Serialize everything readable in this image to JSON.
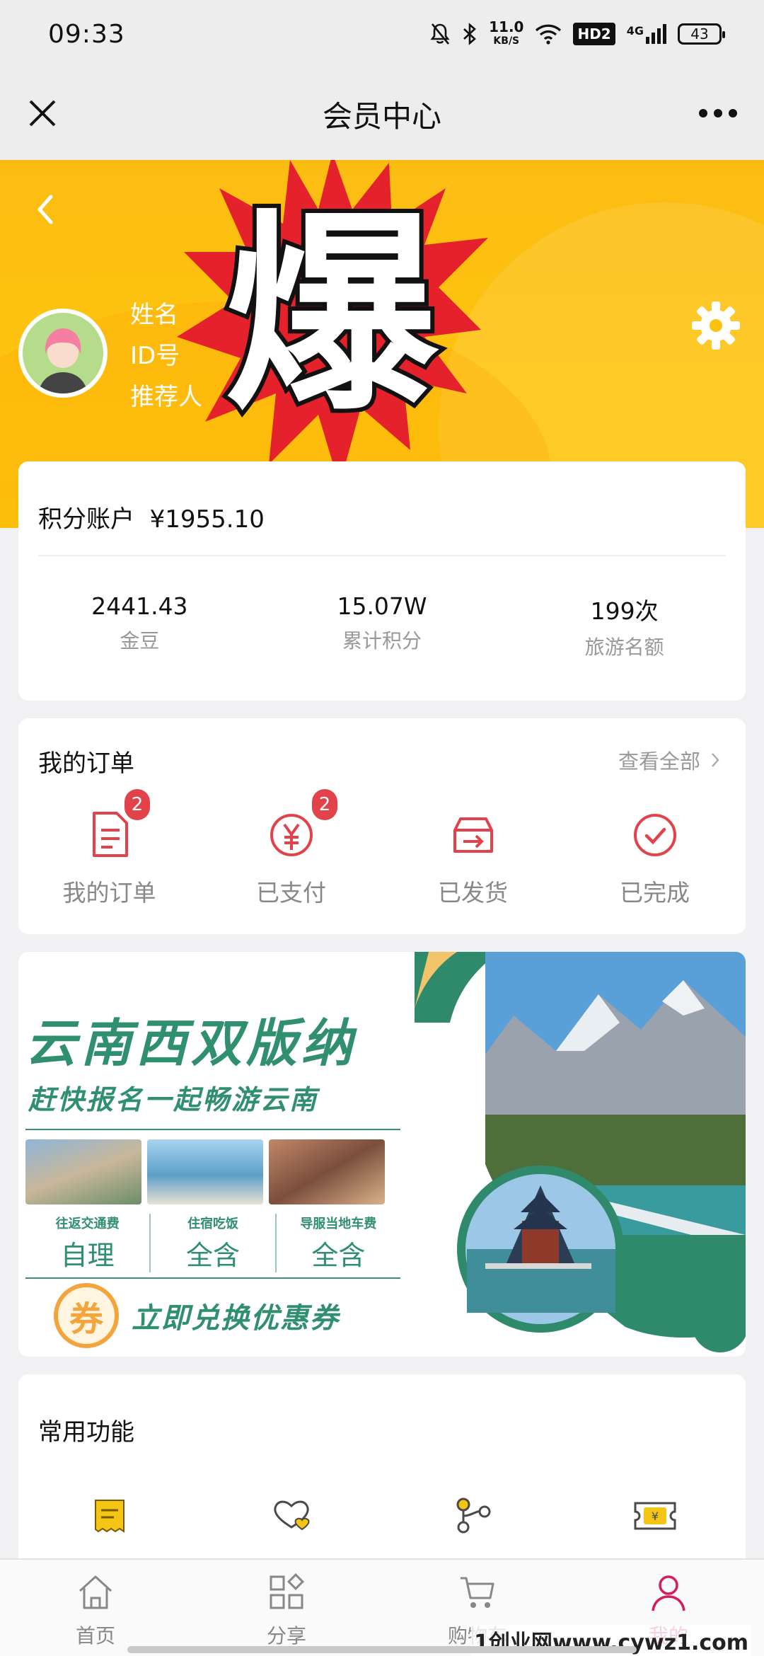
{
  "status_bar": {
    "time": "09:33",
    "net_speed_top": "11.0",
    "net_speed_bottom": "KB/S",
    "hd": "HD2",
    "signal": "4G",
    "battery": "43"
  },
  "title_bar": {
    "title": "会员中心"
  },
  "hero": {
    "name_label": "姓名",
    "id_label": "ID号",
    "referrer_label": "推荐人",
    "sticker": "爆",
    "colors": {
      "bg": "#fdc10f",
      "sticker_red": "#e5222b"
    }
  },
  "points": {
    "title": "积分账户",
    "balance": "¥1955.10",
    "stats": [
      {
        "value": "2441.43",
        "label": "金豆"
      },
      {
        "value": "15.07W",
        "label": "累计积分"
      },
      {
        "value": "199次",
        "label": "旅游名额"
      }
    ]
  },
  "orders": {
    "title": "我的订单",
    "view_all": "查看全部",
    "items": [
      {
        "label": "我的订单",
        "badge": "2",
        "icon": "document-icon"
      },
      {
        "label": "已支付",
        "badge": "2",
        "icon": "yuan-circle-icon"
      },
      {
        "label": "已发货",
        "badge": "",
        "icon": "shipping-box-icon"
      },
      {
        "label": "已完成",
        "badge": "",
        "icon": "check-circle-icon"
      }
    ],
    "accent": "#e2434b"
  },
  "banner": {
    "title": "云南西双版纳",
    "subtitle": "赶快报名一起畅游云南",
    "features": [
      {
        "small": "往返交通费",
        "big": "自理"
      },
      {
        "small": "住宿吃饭",
        "big": "全含"
      },
      {
        "small": "导服当地车费",
        "big": "全含"
      }
    ],
    "coupon_glyph": "券",
    "coupon_text": "立即兑换优惠券",
    "accent": "#2f8f6e"
  },
  "functions": {
    "title": "常用功能",
    "icons": [
      "receipt-icon",
      "heart-hand-icon",
      "share-nodes-icon",
      "ticket-icon"
    ]
  },
  "bottom_nav": {
    "items": [
      {
        "label": "首页",
        "icon": "home-icon"
      },
      {
        "label": "分享",
        "icon": "grid-icon"
      },
      {
        "label": "购物车",
        "icon": "cart-icon"
      },
      {
        "label": "我的",
        "icon": "person-icon",
        "active": true
      }
    ],
    "active_color": "#d51d5b"
  },
  "watermark": "1创业网www.cywz1.com"
}
